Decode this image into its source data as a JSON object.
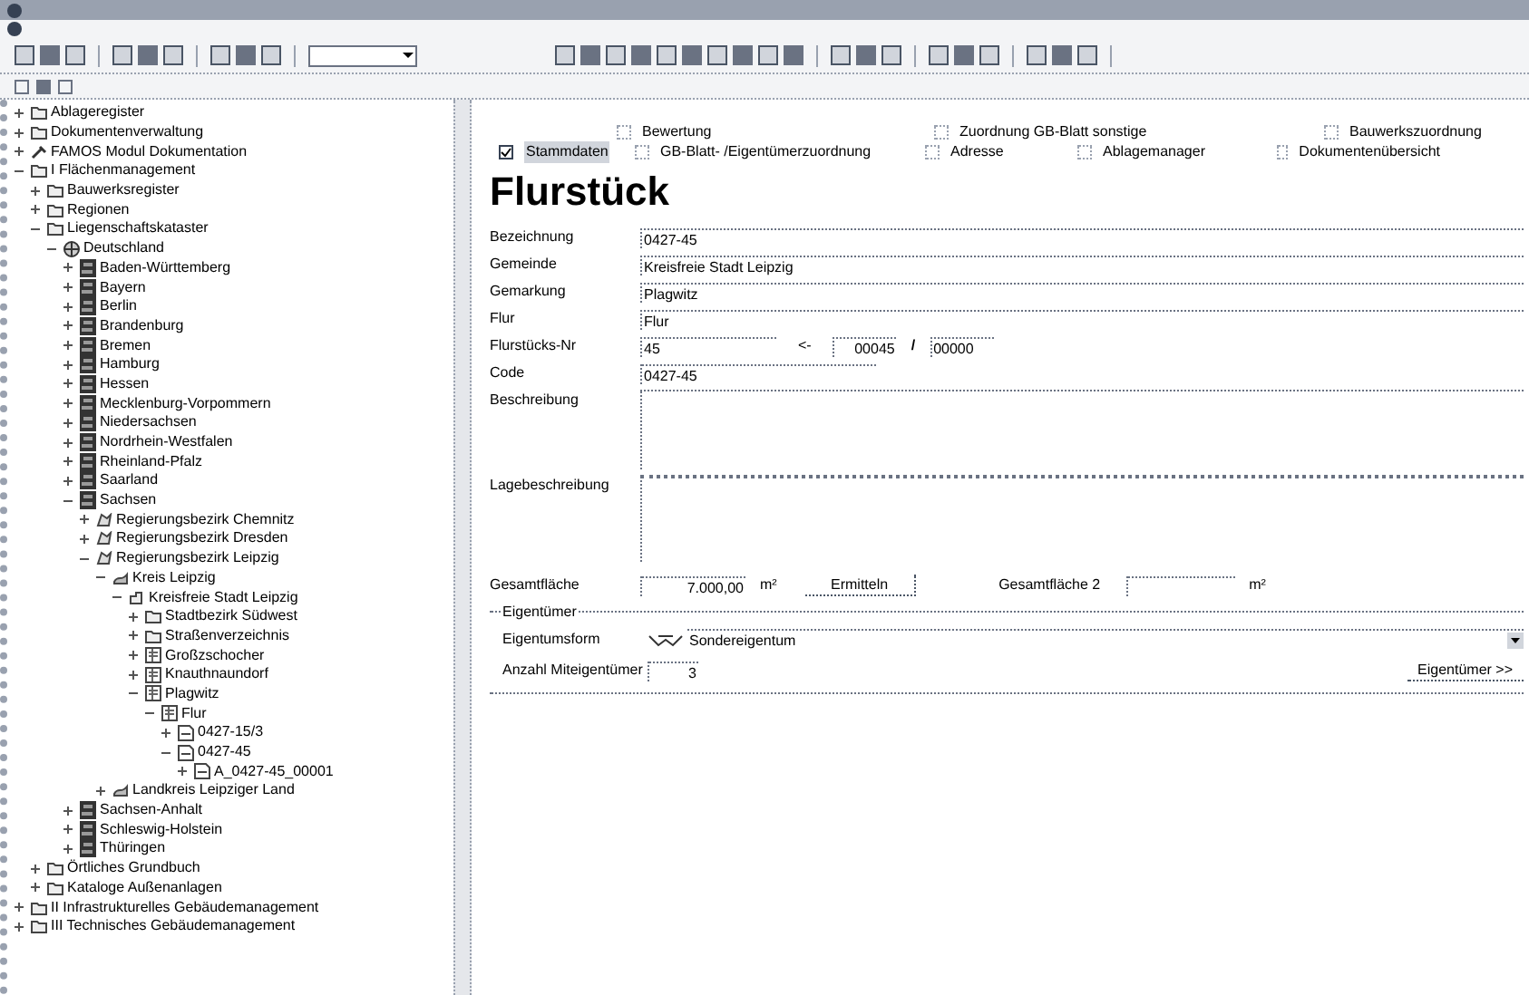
{
  "tree": [
    {
      "label": "Ablageregister",
      "kind": "folder",
      "expanded": false
    },
    {
      "label": "Dokumentenverwaltung",
      "kind": "folder",
      "expanded": false
    },
    {
      "label": "FAMOS Modul Dokumentation",
      "kind": "tool",
      "expanded": false
    },
    {
      "label": "I  Flächenmanagement",
      "kind": "folder",
      "expanded": true,
      "children": [
        {
          "label": "Bauwerksregister",
          "kind": "folder",
          "expanded": false
        },
        {
          "label": "Regionen",
          "kind": "folder",
          "expanded": false
        },
        {
          "label": "Liegenschaftskataster",
          "kind": "folder",
          "expanded": true,
          "children": [
            {
              "label": "Deutschland",
              "kind": "globe",
              "expanded": true,
              "children": [
                {
                  "label": "Baden-Württemberg",
                  "kind": "state",
                  "expanded": false
                },
                {
                  "label": "Bayern",
                  "kind": "state",
                  "expanded": false
                },
                {
                  "label": "Berlin",
                  "kind": "state",
                  "expanded": false
                },
                {
                  "label": "Brandenburg",
                  "kind": "state",
                  "expanded": false
                },
                {
                  "label": "Bremen",
                  "kind": "state",
                  "expanded": false
                },
                {
                  "label": "Hamburg",
                  "kind": "state",
                  "expanded": false
                },
                {
                  "label": "Hessen",
                  "kind": "state",
                  "expanded": false
                },
                {
                  "label": "Mecklenburg-Vorpommern",
                  "kind": "state",
                  "expanded": false
                },
                {
                  "label": "Niedersachsen",
                  "kind": "state",
                  "expanded": false
                },
                {
                  "label": "Nordrhein-Westfalen",
                  "kind": "state",
                  "expanded": false
                },
                {
                  "label": "Rheinland-Pfalz",
                  "kind": "state",
                  "expanded": false
                },
                {
                  "label": "Saarland",
                  "kind": "state",
                  "expanded": false
                },
                {
                  "label": "Sachsen",
                  "kind": "state",
                  "expanded": true,
                  "children": [
                    {
                      "label": "Regierungsbezirk Chemnitz",
                      "kind": "region",
                      "expanded": false
                    },
                    {
                      "label": "Regierungsbezirk Dresden",
                      "kind": "region",
                      "expanded": false
                    },
                    {
                      "label": "Regierungsbezirk Leipzig",
                      "kind": "region",
                      "expanded": true,
                      "children": [
                        {
                          "label": "Kreis Leipzig",
                          "kind": "district",
                          "expanded": true,
                          "children": [
                            {
                              "label": "Kreisfreie Stadt Leipzig",
                              "kind": "city",
                              "expanded": true,
                              "children": [
                                {
                                  "label": "Stadtbezirk Südwest",
                                  "kind": "folder",
                                  "expanded": false
                                },
                                {
                                  "label": "Straßenverzeichnis",
                                  "kind": "folder",
                                  "expanded": false
                                },
                                {
                                  "label": "Großzschocher",
                                  "kind": "map",
                                  "expanded": false
                                },
                                {
                                  "label": "Knauthnaundorf",
                                  "kind": "map",
                                  "expanded": false
                                },
                                {
                                  "label": "Plagwitz",
                                  "kind": "map",
                                  "expanded": true,
                                  "children": [
                                    {
                                      "label": "Flur",
                                      "kind": "map",
                                      "expanded": true,
                                      "children": [
                                        {
                                          "label": "0427-15/3",
                                          "kind": "parcel",
                                          "expanded": false
                                        },
                                        {
                                          "label": "0427-45",
                                          "kind": "parcel",
                                          "expanded": true,
                                          "children": [
                                            {
                                              "label": "A_0427-45_00001",
                                              "kind": "parcel",
                                              "expanded": false
                                            }
                                          ]
                                        }
                                      ]
                                    }
                                  ]
                                }
                              ]
                            }
                          ]
                        },
                        {
                          "label": "Landkreis Leipziger Land",
                          "kind": "district",
                          "expanded": false
                        }
                      ]
                    }
                  ]
                },
                {
                  "label": "Sachsen-Anhalt",
                  "kind": "state",
                  "expanded": false
                },
                {
                  "label": "Schleswig-Holstein",
                  "kind": "state",
                  "expanded": false
                },
                {
                  "label": "Thüringen",
                  "kind": "state",
                  "expanded": false
                }
              ]
            }
          ]
        },
        {
          "label": "Örtliches Grundbuch",
          "kind": "folder",
          "expanded": false
        },
        {
          "label": "Kataloge Außenanlagen",
          "kind": "folder",
          "expanded": false
        }
      ]
    },
    {
      "label": "II  Infrastrukturelles Gebäudemanagement",
      "kind": "folder",
      "expanded": false
    },
    {
      "label": "III  Technisches Gebäudemanagement",
      "kind": "folder",
      "expanded": false
    }
  ],
  "tabs_top": [
    {
      "label": "Bewertung",
      "checked": false
    },
    {
      "label": "Zuordnung GB-Blatt sonstige",
      "checked": false
    },
    {
      "label": "Bauwerkszuordnung",
      "checked": false
    }
  ],
  "tabs_bottom": [
    {
      "label": "Stammdaten",
      "checked": true,
      "selected": true
    },
    {
      "label": "GB-Blatt- /Eigentümerzuordnung",
      "checked": false,
      "selected": false
    },
    {
      "label": "Adresse",
      "checked": false,
      "selected": false
    },
    {
      "label": "Ablagemanager",
      "checked": false,
      "selected": false
    },
    {
      "label": "Dokumentenübersicht",
      "checked": false,
      "selected": false
    }
  ],
  "title": "Flurstück",
  "fields": [
    {
      "label": "Bezeichnung",
      "value": "0427-45"
    },
    {
      "label": "Gemeinde",
      "value": "Kreisfreie Stadt Leipzig"
    },
    {
      "label": "Gemarkung",
      "value": "Plagwitz"
    },
    {
      "label": "Flur",
      "value": "Flur"
    }
  ],
  "flurstueck": {
    "label": "Flurstücks-Nr",
    "value": "45",
    "arrow": "<-",
    "numerator": "00045",
    "separator": "/",
    "denominator": "00000"
  },
  "code": {
    "label": "Code",
    "value": "0427-45"
  },
  "text_areas": [
    {
      "label": "Beschreibung"
    },
    {
      "label": "Lagebeschreibung"
    }
  ],
  "area": {
    "label": "Gesamtfläche",
    "value": "7.000,00",
    "unit": "m²",
    "button": "Ermitteln",
    "label_2": "Gesamtfläche 2",
    "unit_2": "m²"
  },
  "owner_group": {
    "title": "Eigentümer",
    "form_label": "Eigentumsform",
    "form_value": "Sondereigentum",
    "count_label": "Anzahl Miteigentümer",
    "count_value": "3",
    "button": "Eigentümer >>"
  }
}
